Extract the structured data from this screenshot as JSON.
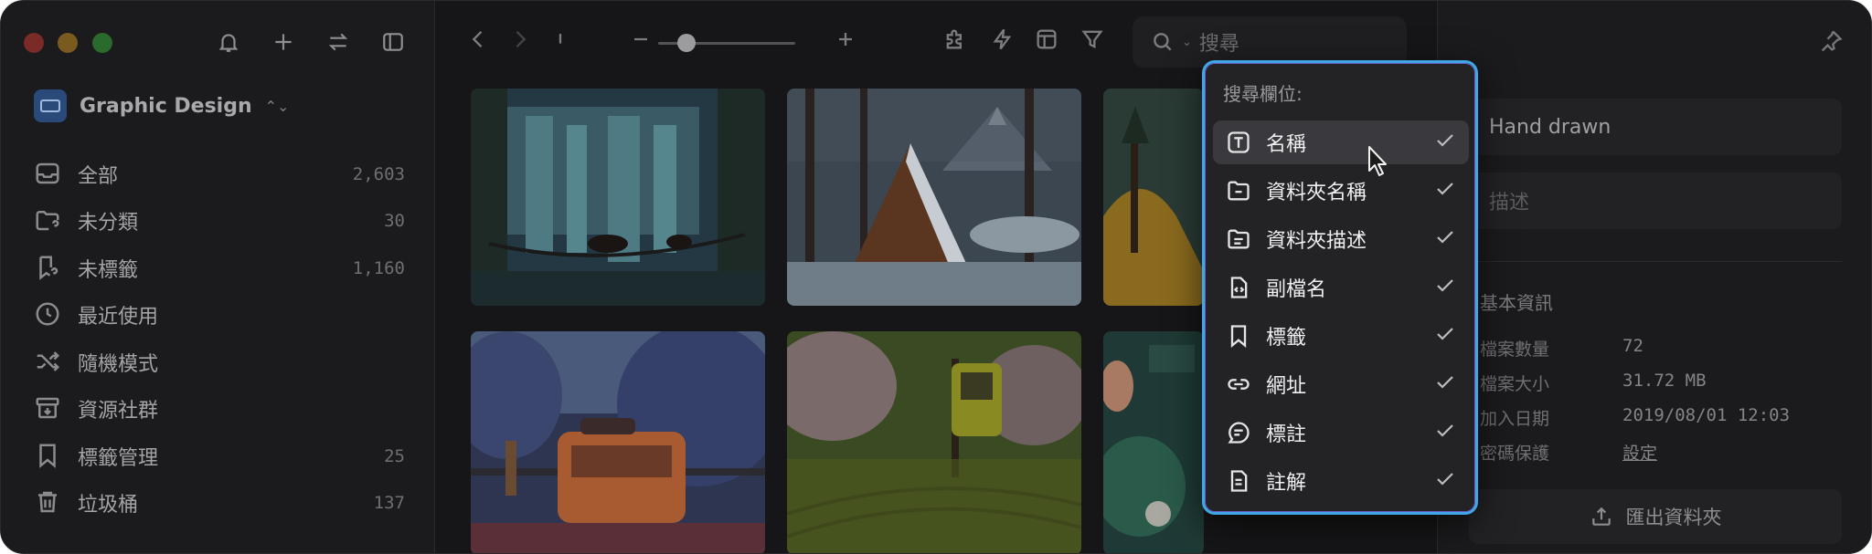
{
  "sidebar": {
    "library_name": "Graphic Design",
    "items": [
      {
        "label": "全部",
        "count": "2,603",
        "icon": "inbox-icon"
      },
      {
        "label": "未分類",
        "count": "30",
        "icon": "folder-question-icon"
      },
      {
        "label": "未標籤",
        "count": "1,160",
        "icon": "tag-question-icon"
      },
      {
        "label": "最近使用",
        "count": "",
        "icon": "clock-icon"
      },
      {
        "label": "隨機模式",
        "count": "",
        "icon": "shuffle-icon"
      },
      {
        "label": "資源社群",
        "count": "",
        "icon": "archive-icon"
      },
      {
        "label": "標籤管理",
        "count": "25",
        "icon": "bookmark-icon"
      },
      {
        "label": "垃圾桶",
        "count": "137",
        "icon": "trash-icon"
      }
    ]
  },
  "toolbar": {
    "search_placeholder": "搜尋",
    "zoom_level": 0.2
  },
  "menu": {
    "title": "搜尋欄位:",
    "items": [
      {
        "label": "名稱",
        "icon": "text-box-icon",
        "checked": true
      },
      {
        "label": "資料夾名稱",
        "icon": "folder-icon",
        "checked": true
      },
      {
        "label": "資料夾描述",
        "icon": "document-lines-icon",
        "checked": true
      },
      {
        "label": "副檔名",
        "icon": "code-file-icon",
        "checked": true
      },
      {
        "label": "標籤",
        "icon": "bookmark-icon",
        "checked": true
      },
      {
        "label": "網址",
        "icon": "link-icon",
        "checked": true
      },
      {
        "label": "標註",
        "icon": "comment-icon",
        "checked": true
      },
      {
        "label": "註解",
        "icon": "note-icon",
        "checked": true
      }
    ]
  },
  "inspector": {
    "name_value": "Hand drawn",
    "desc_placeholder": "描述",
    "section_title": "基本資訊",
    "rows": [
      {
        "label": "檔案數量",
        "value": "72"
      },
      {
        "label": "檔案大小",
        "value": "31.72 MB"
      },
      {
        "label": "加入日期",
        "value": "2019/08/01 12:03"
      },
      {
        "label": "密碼保護",
        "value": "設定"
      }
    ],
    "export_label": "匯出資料夾"
  },
  "colors": {
    "accent_border": "#3fa7e6",
    "window_bg": "#161618",
    "menu_bg": "#232326"
  }
}
